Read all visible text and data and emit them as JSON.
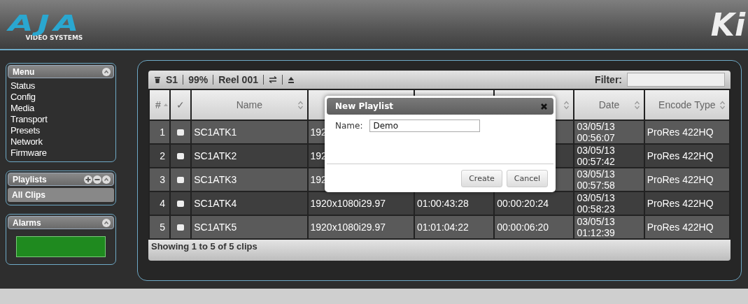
{
  "header": {
    "logo": "AJA",
    "logo_subtitle": "VIDEO SYSTEMS",
    "product_logo": "Ki"
  },
  "sidebar": {
    "menu": {
      "title": "Menu",
      "items": [
        {
          "label": "Status"
        },
        {
          "label": "Config"
        },
        {
          "label": "Media"
        },
        {
          "label": "Transport"
        },
        {
          "label": "Presets"
        },
        {
          "label": "Network"
        },
        {
          "label": "Firmware"
        }
      ]
    },
    "playlists": {
      "title": "Playlists",
      "items": [
        {
          "label": "All Clips",
          "selected": true
        }
      ]
    },
    "alarms": {
      "title": "Alarms"
    }
  },
  "toolbar": {
    "slot": "S1",
    "capacity": "99%",
    "reel": "Reel 001",
    "filter_label": "Filter:"
  },
  "table": {
    "columns": [
      {
        "label": "#",
        "sorted": true
      },
      {
        "label": "✓",
        "sortable": false
      },
      {
        "label": "Name",
        "sortable": true
      },
      {},
      {},
      {
        "sortable": true
      },
      {
        "label": "Date",
        "sortable": true
      },
      {
        "label": "Encode Type",
        "sortable": true
      }
    ],
    "rows": [
      {
        "number": "1",
        "checked": false,
        "name": "SC1ATK1",
        "column_4": "192",
        "date": "03/05/13 00:56:07",
        "encode_type": "ProRes 422HQ"
      },
      {
        "number": "2",
        "checked": false,
        "name": "SC1ATK2",
        "column_4": "192",
        "date": "03/05/13 00:57:42",
        "encode_type": "ProRes 422HQ"
      },
      {
        "number": "3",
        "checked": false,
        "name": "SC1ATK3",
        "column_4": "192",
        "date": "03/05/13 00:57:58",
        "encode_type": "ProRes 422HQ"
      },
      {
        "number": "4",
        "checked": false,
        "name": "SC1ATK4",
        "column_4": "1920x1080i29.97",
        "column_5": "01:00:43:28",
        "column_6": "00:00:20:24",
        "date": "03/05/13 00:58:23",
        "encode_type": "ProRes 422HQ"
      },
      {
        "number": "5",
        "checked": false,
        "name": "SC1ATK5",
        "column_4": "1920x1080i29.97",
        "column_5": "01:01:04:22",
        "column_6": "00:00:06:20",
        "date": "03/05/13 01:12:39",
        "encode_type": "ProRes 422HQ"
      }
    ],
    "footer": "Showing 1 to 5 of 5 clips"
  },
  "dialog": {
    "title": "New Playlist",
    "name_label": "Name:",
    "name_value": "Demo",
    "buttons": [
      "Create",
      "Cancel"
    ]
  }
}
